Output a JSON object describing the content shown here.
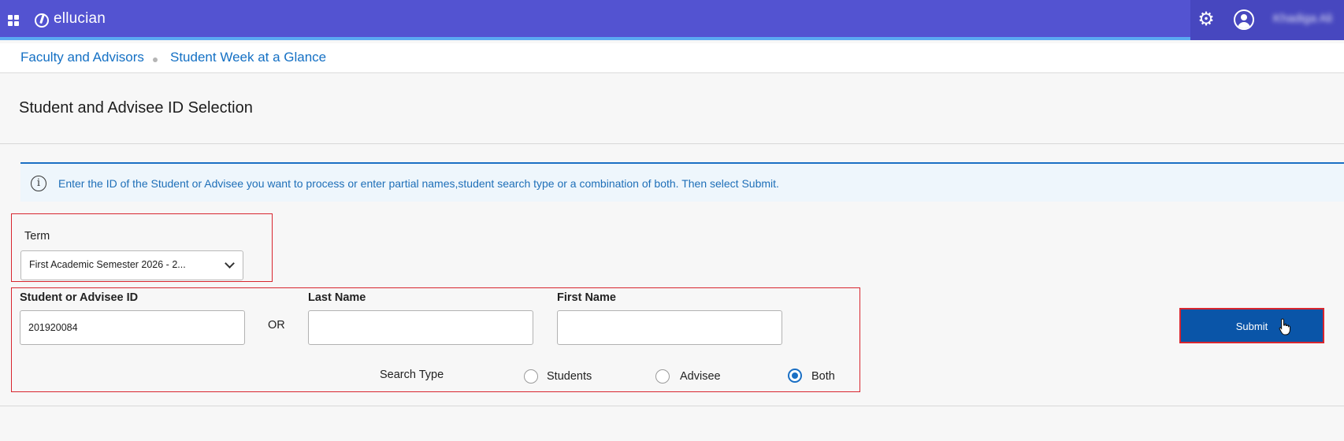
{
  "header": {
    "logo_text": "ellucian",
    "user_name": "Khadiga Ali",
    "icons": [
      "grid-icon",
      "logo-icon",
      "gear-icon",
      "user-icon"
    ]
  },
  "breadcrumb": {
    "items": [
      "Faculty and Advisors",
      "Student Week at a Glance"
    ]
  },
  "page": {
    "title": "Student and Advisee ID Selection"
  },
  "info": {
    "icon": "info-icon",
    "text": "Enter the ID of the Student or Advisee you want to process or enter partial names,student search type or a combination of both. Then select Submit."
  },
  "form": {
    "term_label": "Term",
    "term_value": "First Academic Semester 2026 - 2...",
    "id_label": "Student or Advisee ID",
    "id_value": "201920084",
    "or_label": "OR",
    "last_name_label": "Last Name",
    "last_name_value": "",
    "first_name_label": "First Name",
    "first_name_value": "",
    "search_type_label": "Search Type",
    "search_options": [
      {
        "label": "Students",
        "checked": false
      },
      {
        "label": "Advisee",
        "checked": false
      },
      {
        "label": "Both",
        "checked": true
      }
    ],
    "submit_label": "Submit"
  },
  "colors": {
    "header_bg": "#5353d1",
    "accent_blue": "#1470c4",
    "submit_bg": "#0a55a8",
    "highlight_red": "#d8262f"
  }
}
